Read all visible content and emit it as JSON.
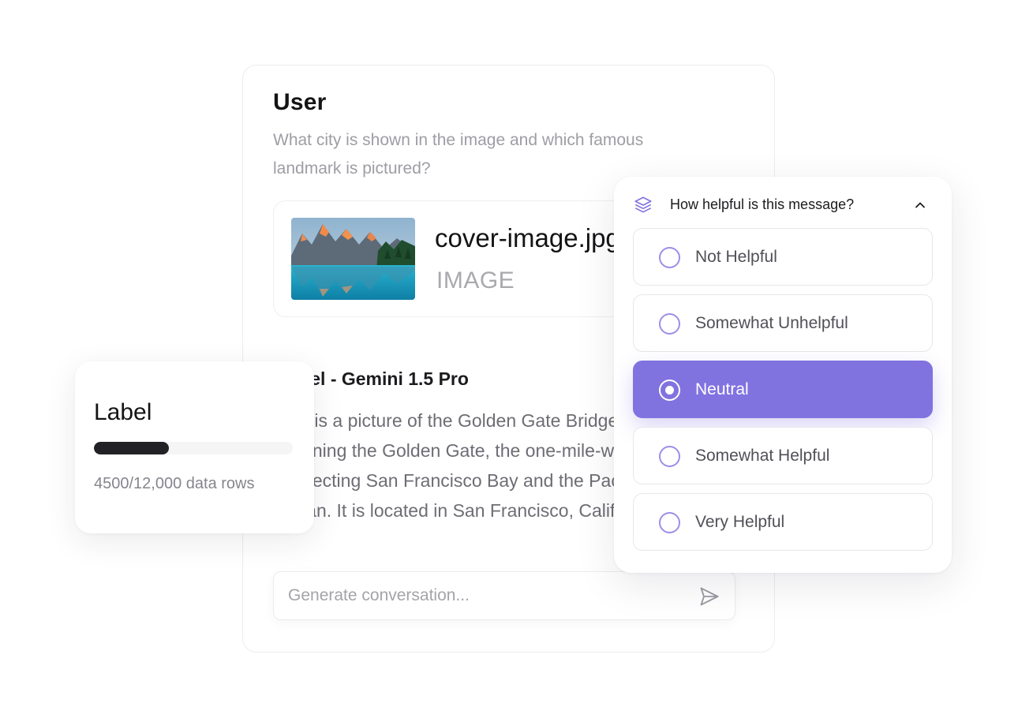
{
  "chat": {
    "user_heading": "User",
    "user_message": "What city is shown in the image and which famous landmark is pictured?",
    "attachment": {
      "file_name": "cover-image.jpg",
      "file_type": "IMAGE",
      "thumbnail_icon": "mountain-lake-photo"
    },
    "model_title": "Model - Gemini 1.5 Pro",
    "model_reply": "That is a picture of the Golden Gate Bridge,\nspanning the Golden Gate, the one-mile-wide strait\nconnecting San Francisco Bay and the Pacific\nOcean. It is located in San Francisco, California.",
    "composer": {
      "placeholder": "Generate conversation...",
      "send_icon": "send-icon"
    }
  },
  "label_card": {
    "title": "Label",
    "progress_fraction": 0.375,
    "caption": "4500/12,000 data rows"
  },
  "rating": {
    "question": "How helpful is this message?",
    "header_icon": "layers-icon",
    "toggle_icon": "chevron-up-icon",
    "accent_color": "#8073e0",
    "selected": "Neutral",
    "options": [
      {
        "label": "Not Helpful"
      },
      {
        "label": "Somewhat Unhelpful"
      },
      {
        "label": "Neutral"
      },
      {
        "label": "Somewhat Helpful"
      },
      {
        "label": "Very Helpful"
      }
    ]
  }
}
